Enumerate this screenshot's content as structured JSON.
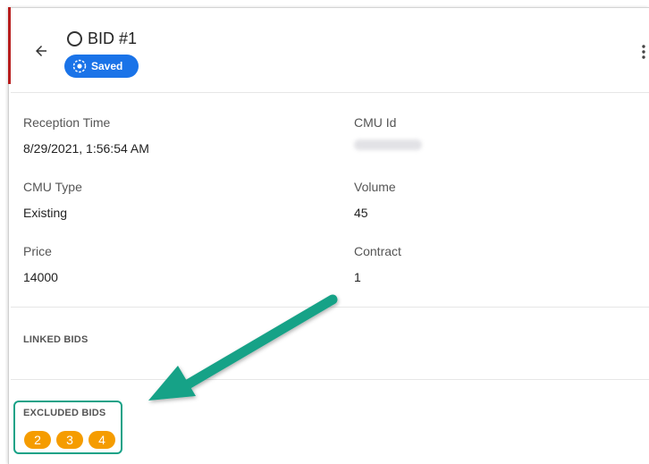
{
  "header": {
    "title": "BID #1",
    "status_chip": "Saved",
    "back_icon": "arrow-left-icon",
    "menu_icon": "more-vertical-icon"
  },
  "fields": {
    "reception_time": {
      "label": "Reception Time",
      "value": "8/29/2021, 1:56:54 AM"
    },
    "cmu_id": {
      "label": "CMU Id"
    },
    "cmu_type": {
      "label": "CMU Type",
      "value": "Existing"
    },
    "volume": {
      "label": "Volume",
      "value": "45"
    },
    "price": {
      "label": "Price",
      "value": "14000"
    },
    "contract": {
      "label": "Contract",
      "value": "1"
    }
  },
  "linked_bids": {
    "title": "LINKED BIDS"
  },
  "excluded_bids": {
    "title": "EXCLUDED BIDS",
    "items": [
      "2",
      "3",
      "4"
    ]
  },
  "colors": {
    "accent_blue": "#1a73e8",
    "badge_orange": "#f59c00",
    "annotation_teal": "#17a287",
    "edge_red": "#b71c1c"
  }
}
